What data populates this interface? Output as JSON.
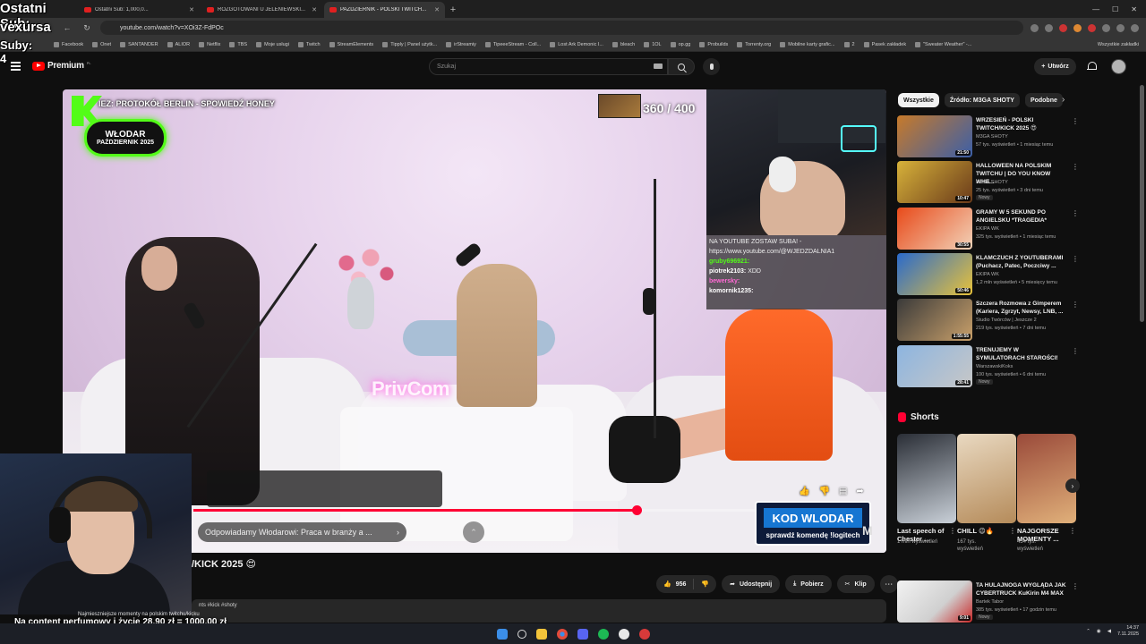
{
  "browser": {
    "tabs": [
      {
        "title": "Ostatni Sub: 1,000,0...",
        "active": false
      },
      {
        "title": "ROZGOTOWANI U JELENIEWSKI...",
        "active": false
      },
      {
        "title": "PAŹDZIERNIK - POLSKI TWITCH...",
        "active": true
      }
    ],
    "new_tab": "+",
    "url": "youtube.com/watch?v=XOi3Z-FdPOc",
    "bookmarks": [
      "Facebook",
      "Onet",
      "SANTANDER",
      "ALIOR",
      "Netflix",
      "TBS",
      "Moje usługi",
      "Twitch",
      "StreamElements",
      "Tipply | Panel użytk...",
      "irStreamiy",
      "TipeeeStream - Coll...",
      "Lost Ark Demonic I...",
      "bleach",
      "1OL",
      "op.gg",
      "Probuilds",
      "Torrenty.org",
      "Mobilne karty grafic...",
      "2",
      "Pasek zakładek",
      "\"Sweater Weather\" -..."
    ],
    "bookmarks_right": "Wszystkie zakładki"
  },
  "yt": {
    "logo": "Premium",
    "country": "PL",
    "search_placeholder": "Szukaj",
    "create_label": "Utwórz"
  },
  "player": {
    "overlay_title": "IEZ: PROTOKÓŁ BERLIN - SPOWIEDŹ HONEY",
    "badge_name": "WŁODAR",
    "badge_month": "PAŹDZIERNIK 2025",
    "goal": "360 / 400",
    "watermark": "PrivCom",
    "chat": [
      {
        "user": "",
        "text": "NA YOUTUBE ZOSTAW SUBA! -",
        "cls": "u-white"
      },
      {
        "user": "",
        "text": "https://www.youtube.com/@WJEDZDALNIA1",
        "cls": "u-white"
      },
      {
        "user": "gruby696921:",
        "text": "",
        "cls": "u-green"
      },
      {
        "user": "piotrek2103:",
        "text": " XDD",
        "cls": "u-white"
      },
      {
        "user": "bewersky:",
        "text": "",
        "cls": "u-pink"
      },
      {
        "user": "komornik1235:",
        "text": "",
        "cls": "u-white"
      }
    ],
    "progress_fraction": 0.79,
    "chapter": "Odpowiadamy Włodarowi: Praca w branży a ...",
    "code_main": "KOD WLODAR",
    "code_sub": "sprawdź komendę !logitech",
    "m_logo": "M"
  },
  "overlay": {
    "sub_label": "Ostatni Sub:",
    "sub_name": "vexursa",
    "subs": "Suby: 4"
  },
  "video": {
    "title": "/KICK 2025 😍",
    "likes": "956",
    "share": "Udostępnij",
    "download": "Pobierz",
    "clip": "Klip",
    "desc_hashtags": "Najmieszniejsze momenty na polskim twitchu/kicku",
    "desc_right": "nts #kick #shoty",
    "subtitle_overlay": "Na content perfumowy i życie 28,90 zł = 1000,00 zł"
  },
  "sidebar": {
    "chips": [
      "Wszystkie",
      "Źródło: M3GA SHOTY",
      "Podobne"
    ],
    "recs": [
      {
        "title": "WRZESIEŃ - POLSKI TWITCH/KICK 2025 😍",
        "channel": "M3GA SHOTY",
        "meta": "57 tys. wyświetleń • 1 miesiąc temu",
        "dur": "21:50",
        "badge": "",
        "colors": [
          "#c77a2a",
          "#3b5fa8"
        ]
      },
      {
        "title": "HALLOWEEN NA POLSKIM TWITCHU | DO YOU KNOW WHE...",
        "channel": "M3GA SHOTY",
        "meta": "25 tys. wyświetleń • 3 dni temu",
        "dur": "10:47",
        "badge": "Nowy",
        "colors": [
          "#d7b23a",
          "#6a3a1a"
        ]
      },
      {
        "title": "GRAMY W 5 SEKUND PO ANGIELSKU *TRAGEDIA*",
        "channel": "EKIPA WK",
        "meta": "325 tys. wyświetleń • 1 miesiąc temu",
        "dur": "30:55",
        "badge": "",
        "colors": [
          "#e84a1a",
          "#f2d2b8"
        ]
      },
      {
        "title": "KLAMCZUCH Z YOUTUBERAMI (Puchacz, Patec, Poczciwy ...",
        "channel": "EKIPA WK",
        "meta": "1,2 mln wyświetleń • 5 miesięcy temu",
        "dur": "50:46",
        "badge": "",
        "colors": [
          "#2a6acb",
          "#e8c23a"
        ]
      },
      {
        "title": "Szczera Rozmowa z Gimperem (Kariera, Zgrzyt, Newsy, LNB, ...",
        "channel": "Studio Twórców | Jeszcze 2",
        "meta": "219 tys. wyświetleń • 7 dni temu",
        "dur": "1:55:55",
        "badge": "",
        "colors": [
          "#3a3a3a",
          "#c9a06a"
        ]
      },
      {
        "title": "TRENUJEMY W SYMULATORACH STAROŚCI!",
        "channel": "WarszawskiKoks",
        "meta": "100 tys. wyświetleń • 6 dni temu",
        "dur": "28:41",
        "badge": "Nowy",
        "colors": [
          "#8db5e0",
          "#c7c7c7"
        ]
      }
    ],
    "shorts_label": "Shorts",
    "shorts": [
      {
        "title": "Last speech of Chester ...",
        "views": "1 mln wyświetleń",
        "colors": [
          "#2a2e36",
          "#c9d0d8"
        ]
      },
      {
        "title": "CHILL 😉🔥",
        "views": "167 tys. wyświetleń",
        "colors": [
          "#e9d9c1",
          "#b58b5a"
        ]
      },
      {
        "title": "NAJGORSZE MOMENTY ...",
        "views": "454 tys. wyświetleń",
        "colors": [
          "#9a4a3a",
          "#e0b07a"
        ]
      }
    ],
    "last_rec": {
      "title": "TA HULAJNOGA WYGLĄDA JAK CYBERTRUCK KuKirin M4 MAX",
      "channel": "Bartek Tabor",
      "meta": "385 tys. wyświetleń • 17 godzin temu",
      "dur": "9:01",
      "badge": "Nowy"
    }
  },
  "taskbar": {
    "time": "14:37",
    "date": "7.11.2025"
  }
}
